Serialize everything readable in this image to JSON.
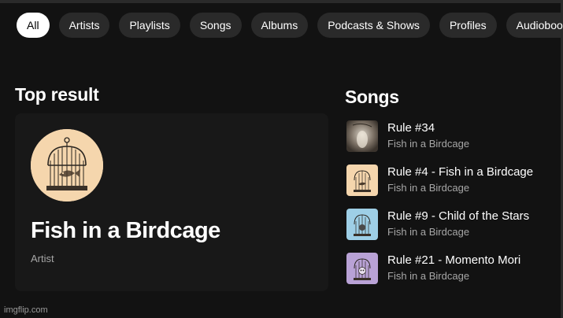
{
  "filters": {
    "chips": [
      {
        "label": "All",
        "active": true
      },
      {
        "label": "Artists",
        "active": false
      },
      {
        "label": "Playlists",
        "active": false
      },
      {
        "label": "Songs",
        "active": false
      },
      {
        "label": "Albums",
        "active": false
      },
      {
        "label": "Podcasts & Shows",
        "active": false
      },
      {
        "label": "Profiles",
        "active": false
      },
      {
        "label": "Audiobooks",
        "active": false
      }
    ]
  },
  "top_result": {
    "heading": "Top result",
    "name": "Fish in a Birdcage",
    "type": "Artist",
    "avatar_icon": "birdcage-with-fish-icon"
  },
  "songs": {
    "heading": "Songs",
    "items": [
      {
        "title": "Rule #34",
        "artist": "Fish in a Birdcage",
        "art_color": "#8a7f72"
      },
      {
        "title": "Rule #4 - Fish in a Birdcage",
        "artist": "Fish in a Birdcage",
        "art_color": "#f5d6ad"
      },
      {
        "title": "Rule #9 - Child of the Stars",
        "artist": "Fish in a Birdcage",
        "art_color": "#9ecfe6"
      },
      {
        "title": "Rule #21 - Momento Mori",
        "artist": "Fish in a Birdcage",
        "art_color": "#b9a2d6"
      }
    ]
  },
  "watermark": "imgflip.com",
  "colors": {
    "background": "#121212",
    "card": "#181818",
    "chip": "#2a2a2a",
    "chip_active": "#ffffff",
    "subtext": "#a7a7a7"
  }
}
